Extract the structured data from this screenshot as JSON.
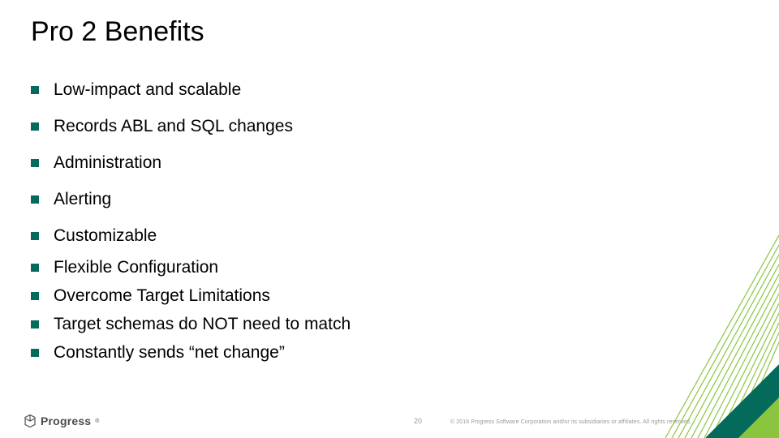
{
  "title": "Pro 2 Benefits",
  "bullets": [
    "Low-impact and scalable",
    "Records ABL and SQL changes",
    "Administration",
    "Alerting",
    "Customizable",
    "Flexible Configuration",
    "Overcome Target Limitations",
    "Target schemas do NOT need to match",
    "Constantly sends “net change”"
  ],
  "footer": {
    "logo_text": "Progress",
    "page_number": "20",
    "copyright": "© 2016 Progress Software Corporation and/or its subsidiaries or affiliates. All rights reserved."
  },
  "colors": {
    "accent": "#046b5c",
    "light": "#8bc53f"
  }
}
